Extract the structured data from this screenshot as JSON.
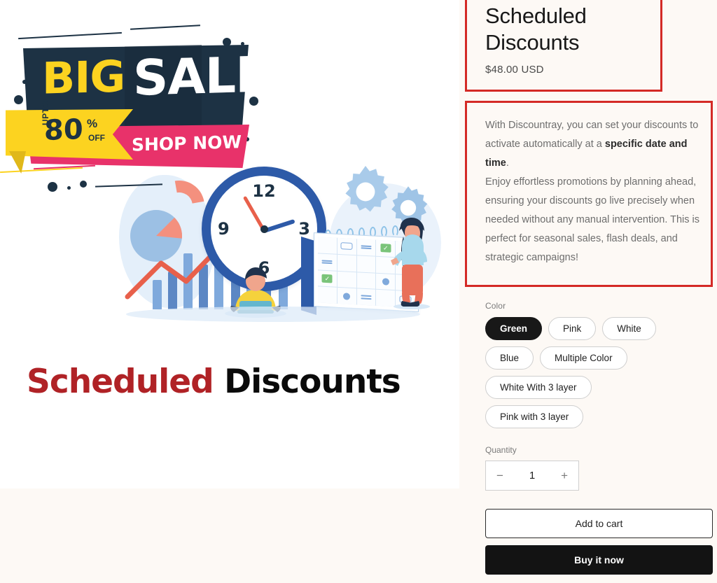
{
  "product": {
    "title": "Scheduled Discounts",
    "price": "$48.00 USD",
    "description": {
      "part1": "With Discountray, you can set your discounts to activate automatically at a ",
      "bold": "specific date and time",
      "part2": ".",
      "part3": "Enjoy effortless promotions by planning ahead, ensuring your discounts go live precisely when needed without any manual intervention. This is perfect for seasonal sales, flash deals, and strategic campaigns!"
    }
  },
  "options": {
    "color_label": "Color",
    "colors": [
      {
        "label": "Green",
        "selected": true
      },
      {
        "label": "Pink",
        "selected": false
      },
      {
        "label": "White",
        "selected": false
      },
      {
        "label": "Blue",
        "selected": false
      },
      {
        "label": "Multiple Color",
        "selected": false
      },
      {
        "label": "White With 3 layer",
        "selected": false
      },
      {
        "label": "Pink with 3 layer",
        "selected": false
      }
    ]
  },
  "quantity": {
    "label": "Quantity",
    "value": "1",
    "decrease_icon": "−",
    "increase_icon": "+"
  },
  "actions": {
    "add_to_cart": "Add to cart",
    "buy_it_now": "Buy it now"
  },
  "media": {
    "banner": {
      "big": "BIG",
      "sale": "SALE",
      "upto": "UPTO",
      "percent_value": "80",
      "percent_sign": "%",
      "off": "OFF",
      "cta": "SHOP NOW >"
    },
    "clock": {
      "n12": "12",
      "n3": "3",
      "n6": "6",
      "n9": "9"
    },
    "headline": {
      "word1": "Scheduled",
      "word2": "Discounts"
    }
  },
  "colors": {
    "page_background": "#FDF9F5",
    "media_background": "#FFFFFF",
    "annotation_red": "#D42A26",
    "banner_navy": "#1D3244",
    "banner_yellow": "#FCD320",
    "banner_pink": "#E8326A",
    "headline_red": "#B02226",
    "headline_black": "#0A0A0A",
    "selected_pill": "#181818",
    "buy_now_button": "#131313",
    "clock_rim_blue": "#2D5AA8",
    "accent_coral": "#E8604B"
  }
}
